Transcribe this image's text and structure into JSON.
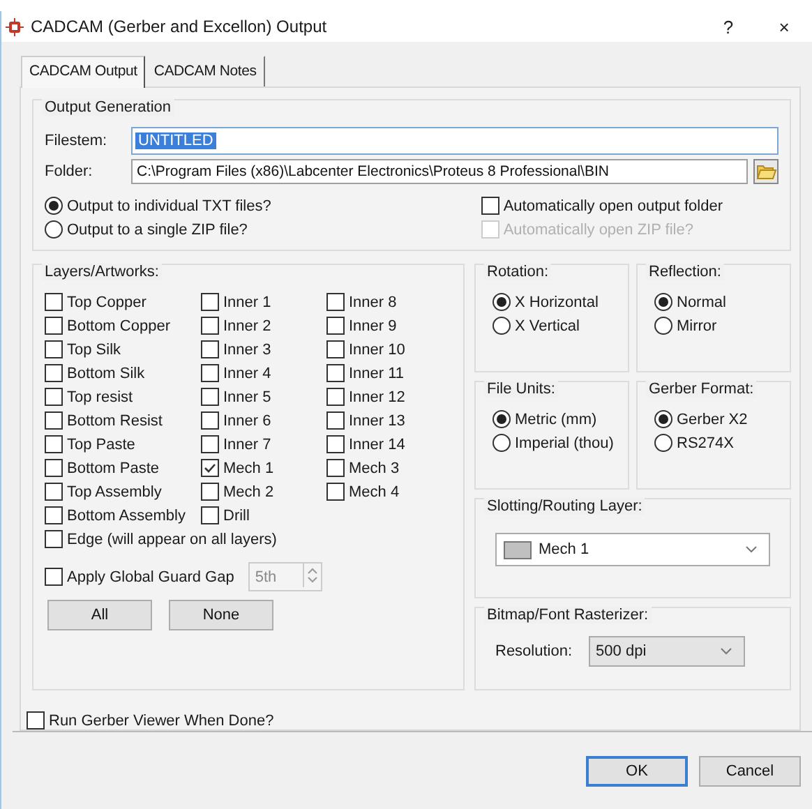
{
  "window": {
    "title": "CADCAM (Gerber and Excellon) Output",
    "help": "?",
    "close": "×"
  },
  "tabs": [
    {
      "label": "CADCAM Output",
      "selected": true
    },
    {
      "label": "CADCAM Notes",
      "selected": false
    }
  ],
  "output_generation": {
    "title": "Output Generation",
    "filestem": {
      "label": "Filestem:",
      "value": "UNTITLED",
      "highlighted": true
    },
    "folder": {
      "label": "Folder:",
      "value": "C:\\Program Files (x86)\\Labcenter Electronics\\Proteus 8 Professional\\BIN"
    },
    "output_mode": [
      {
        "label": "Output to individual TXT files?",
        "selected": true
      },
      {
        "label": "Output to a single ZIP file?",
        "selected": false
      }
    ],
    "auto_open": [
      {
        "label": "Automatically open output folder",
        "checked": false,
        "disabled": false
      },
      {
        "label": "Automatically open ZIP file?",
        "checked": false,
        "disabled": true
      }
    ]
  },
  "layers": {
    "title": "Layers/Artworks:",
    "columns": [
      [
        {
          "label": "Top Copper",
          "checked": false
        },
        {
          "label": "Bottom Copper",
          "checked": false
        },
        {
          "label": "Top Silk",
          "checked": false
        },
        {
          "label": "Bottom Silk",
          "checked": false
        },
        {
          "label": "Top resist",
          "checked": false
        },
        {
          "label": "Bottom Resist",
          "checked": false
        },
        {
          "label": "Top Paste",
          "checked": false
        },
        {
          "label": "Bottom Paste",
          "checked": false
        },
        {
          "label": "Top Assembly",
          "checked": false
        },
        {
          "label": "Bottom Assembly",
          "checked": false
        }
      ],
      [
        {
          "label": "Inner 1",
          "checked": false
        },
        {
          "label": "Inner 2",
          "checked": false
        },
        {
          "label": "Inner 3",
          "checked": false
        },
        {
          "label": "Inner 4",
          "checked": false
        },
        {
          "label": "Inner 5",
          "checked": false
        },
        {
          "label": "Inner 6",
          "checked": false
        },
        {
          "label": "Inner 7",
          "checked": false
        },
        {
          "label": "Mech 1",
          "checked": true
        },
        {
          "label": "Mech 2",
          "checked": false
        },
        {
          "label": "Drill",
          "checked": false
        }
      ],
      [
        {
          "label": "Inner 8",
          "checked": false
        },
        {
          "label": "Inner 9",
          "checked": false
        },
        {
          "label": "Inner 10",
          "checked": false
        },
        {
          "label": "Inner 11",
          "checked": false
        },
        {
          "label": "Inner 12",
          "checked": false
        },
        {
          "label": "Inner 13",
          "checked": false
        },
        {
          "label": "Inner 14",
          "checked": false
        },
        {
          "label": "Mech 3",
          "checked": false
        },
        {
          "label": "Mech 4",
          "checked": false
        }
      ]
    ],
    "edge": {
      "label": "Edge (will appear on all layers)",
      "checked": false
    },
    "guard_gap": {
      "label": "Apply Global Guard Gap",
      "checked": false,
      "value": "5th"
    },
    "buttons": [
      "All",
      "None"
    ]
  },
  "rotation": {
    "title": "Rotation:",
    "options": [
      {
        "label": "X Horizontal",
        "selected": true
      },
      {
        "label": "X Vertical",
        "selected": false
      }
    ]
  },
  "reflection": {
    "title": "Reflection:",
    "options": [
      {
        "label": "Normal",
        "selected": true
      },
      {
        "label": "Mirror",
        "selected": false
      }
    ]
  },
  "file_units": {
    "title": "File Units:",
    "options": [
      {
        "label": "Metric (mm)",
        "selected": true
      },
      {
        "label": "Imperial (thou)",
        "selected": false
      }
    ]
  },
  "gerber_format": {
    "title": "Gerber Format:",
    "options": [
      {
        "label": "Gerber X2",
        "selected": true
      },
      {
        "label": "RS274X",
        "selected": false
      }
    ]
  },
  "slotting": {
    "title": "Slotting/Routing Layer:",
    "value": "Mech 1",
    "color": "#c0c0c0"
  },
  "rasterizer": {
    "title": "Bitmap/Font Rasterizer:",
    "label": "Resolution:",
    "value": "500 dpi"
  },
  "run_viewer": {
    "label": "Run Gerber Viewer When Done?",
    "checked": false
  },
  "buttons": [
    {
      "label": "OK",
      "default": true
    },
    {
      "label": "Cancel",
      "default": false
    }
  ]
}
